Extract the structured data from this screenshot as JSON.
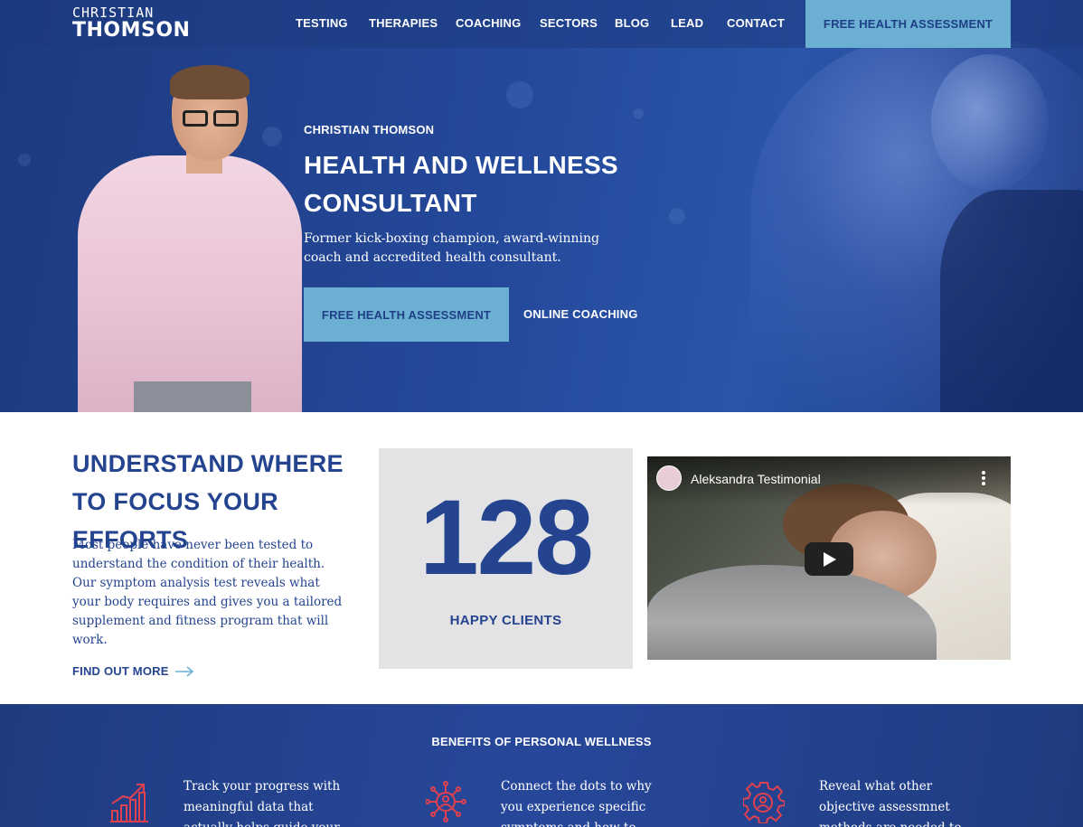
{
  "brand": {
    "logo_line1": "CHRISTIAN",
    "logo_line2": "THOMSON"
  },
  "nav": {
    "items": [
      {
        "label": "TESTING"
      },
      {
        "label": "THERAPIES"
      },
      {
        "label": "COACHING"
      },
      {
        "label": "SECTORS"
      },
      {
        "label": "BLOG"
      },
      {
        "label": "LEAD"
      },
      {
        "label": "CONTACT"
      }
    ],
    "cta_label": "FREE HEALTH ASSESSMENT"
  },
  "hero": {
    "eyebrow": "CHRISTIAN THOMSON",
    "title": "HEALTH AND WELLNESS CONSULTANT",
    "subtitle": "Former kick-boxing champion, award-winning coach and accredited health consultant.",
    "primary_button": "FREE HEALTH ASSESSMENT",
    "secondary_link": "ONLINE COACHING"
  },
  "focus": {
    "title": "UNDERSTAND WHERE TO FOCUS YOUR EFFORTS",
    "body": "Most people have never been tested to understand the condition of their health. Our symptom analysis test reveals what your body requires and gives you a tailored supplement and fitness program that will work.",
    "link_label": "FIND OUT MORE",
    "link_icon": "arrow-right-icon"
  },
  "stat": {
    "number": "128",
    "label": "HAPPY CLIENTS"
  },
  "video": {
    "title": "Aleksandra Testimonial"
  },
  "benefits": {
    "title": "BENEFITS OF PERSONAL WELLNESS",
    "items": [
      {
        "icon": "chart-growth-icon",
        "text": "Track your progress with meaningful data that actually helps guide your"
      },
      {
        "icon": "network-person-icon",
        "text": "Connect the dots to why you experience specific symptoms and how to"
      },
      {
        "icon": "gear-person-icon",
        "text": "Reveal what other objective assessmnet methods are needed to"
      }
    ]
  },
  "colors": {
    "primary_blue": "#24448f",
    "accent_light_blue": "#6bb0d3",
    "icon_red": "#e0414f",
    "stat_box_gray": "#e3e3e5"
  }
}
